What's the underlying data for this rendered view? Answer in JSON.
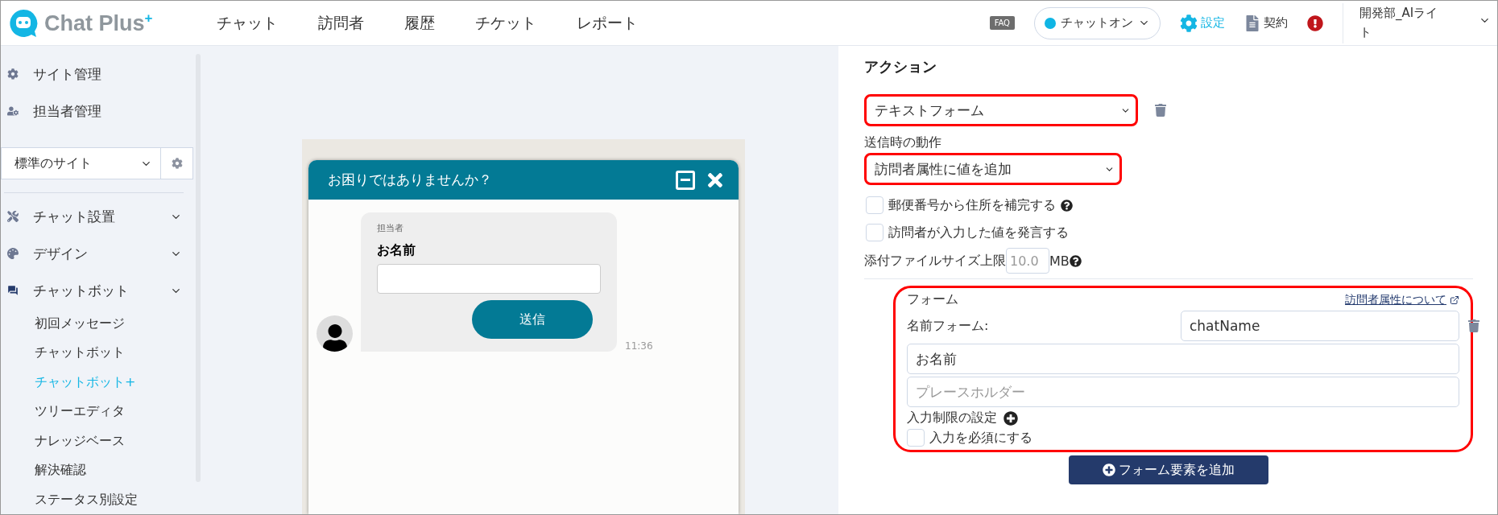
{
  "header": {
    "logo": "Chat Plus",
    "logo_mark": "+",
    "nav": [
      {
        "label": "チャット"
      },
      {
        "label": "訪問者"
      },
      {
        "label": "履歴"
      },
      {
        "label": "チケット"
      },
      {
        "label": "レポート"
      }
    ],
    "faq": "FAQ",
    "status": {
      "label": "チャットオン",
      "on": true
    },
    "settings": "設定",
    "contract": "契約",
    "user": "開発部_AIライト"
  },
  "sidebar": {
    "top_items": [
      {
        "label": "サイト管理",
        "kind": "gear"
      },
      {
        "label": "担当者管理",
        "kind": "user"
      }
    ],
    "site_select": "標準のサイト",
    "sections": [
      {
        "label": "チャット設置",
        "kind": "tools"
      },
      {
        "label": "デザイン",
        "kind": "palette"
      },
      {
        "label": "チャットボット",
        "kind": "chat",
        "children": [
          {
            "label": "初回メッセージ",
            "selected": false
          },
          {
            "label": "チャットボット",
            "selected": false
          },
          {
            "label": "チャットボット+",
            "selected": true
          },
          {
            "label": "ツリーエディタ",
            "selected": false
          },
          {
            "label": "ナレッジベース",
            "selected": false
          },
          {
            "label": "解決確認",
            "selected": false
          },
          {
            "label": "ステータス別設定",
            "selected": false
          }
        ]
      }
    ]
  },
  "preview": {
    "title": "お困りではありませんか？",
    "agent": "担当者",
    "field_label": "お名前",
    "send": "送信",
    "time": "11:36"
  },
  "action": {
    "heading": "アクション",
    "type_select": {
      "value": "テキストフォーム",
      "highlighted": true
    },
    "on_send_label": "送信時の動作",
    "on_send_select": {
      "value": "訪問者属性に値を追加",
      "highlighted": true
    },
    "checkboxes": [
      {
        "label": "郵便番号から住所を補完する",
        "checked": false,
        "help": true
      },
      {
        "label": "訪問者が入力した値を発言する",
        "checked": false,
        "help": false
      }
    ],
    "attach": {
      "label": "添付ファイルサイズ上限",
      "placeholder": "10.0",
      "unit": "MB"
    },
    "form": {
      "highlighted": true,
      "title": "フォーム",
      "link": "訪問者属性について",
      "name_label": "名前フォーム:",
      "name_value": "chatName",
      "label_value": "お名前",
      "placeholder": "プレースホルダー",
      "restriction": "入力制限の設定",
      "required": {
        "label": "入力を必須にする",
        "checked": false
      }
    },
    "add_button": "フォーム要素を追加"
  }
}
